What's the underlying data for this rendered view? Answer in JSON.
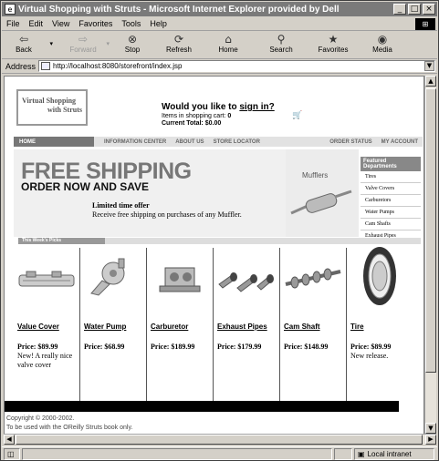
{
  "window": {
    "title": "Virtual Shopping with Struts - Microsoft Internet Explorer provided by Dell",
    "controls": [
      "_",
      "□",
      "×"
    ]
  },
  "menu": {
    "items": [
      "File",
      "Edit",
      "View",
      "Favorites",
      "Tools",
      "Help"
    ]
  },
  "toolbar": {
    "buttons": [
      {
        "label": "Back",
        "icon": "back-arrow-icon",
        "glyph": "⇦"
      },
      {
        "label": "Forward",
        "icon": "forward-arrow-icon",
        "glyph": "⇨"
      },
      {
        "label": "Stop",
        "icon": "stop-icon",
        "glyph": "⊗"
      },
      {
        "label": "Refresh",
        "icon": "refresh-icon",
        "glyph": "⟳"
      },
      {
        "label": "Home",
        "icon": "home-icon",
        "glyph": "⌂"
      },
      {
        "label": "Search",
        "icon": "search-icon",
        "glyph": "⚲"
      },
      {
        "label": "Favorites",
        "icon": "favorites-icon",
        "glyph": "★"
      },
      {
        "label": "Media",
        "icon": "media-icon",
        "glyph": "◉"
      }
    ]
  },
  "address": {
    "label": "Address",
    "url": "http://localhost:8080/storefront/index.jsp"
  },
  "page": {
    "logo": {
      "line1": "Virtual Shopping",
      "line2": "with Struts"
    },
    "welcome": {
      "question": "Would you like to",
      "signin": "sign in?",
      "items_label": "Items in shopping cart:",
      "items_count": "0",
      "total_label": "Current Total:",
      "total_value": "$0.00"
    },
    "nav": {
      "home": "HOME",
      "left": [
        "INFORMATION CENTER",
        "ABOUT US",
        "STORE LOCATOR"
      ],
      "right": [
        "ORDER STATUS",
        "MY ACCOUNT"
      ]
    },
    "banner": {
      "headline": "FREE SHIPPING",
      "subhead": "ORDER NOW AND SAVE",
      "offer": "Limited time offer",
      "desc": "Receive free shipping on purchases of any Muffler.",
      "panel_label": "Mufflers"
    },
    "featured": {
      "heading": "Featured Departments",
      "items": [
        "Tires",
        "Valve Covers",
        "Carburetors",
        "Water Pumps",
        "Cam Shafts",
        "Exhaust Pipes"
      ]
    },
    "week_label": "This Week's Picks",
    "products": [
      {
        "name": "Value Cover",
        "price": "Price: $89.99",
        "note": "New! A really nice valve cover",
        "icon": "valve-cover-icon"
      },
      {
        "name": "Water Pump",
        "price": "Price: $68.99",
        "note": "",
        "icon": "water-pump-icon"
      },
      {
        "name": "Carburetor",
        "price": "Price: $189.99",
        "note": "",
        "icon": "carburetor-icon"
      },
      {
        "name": "Exhaust Pipes",
        "price": "Price: $179.99",
        "note": "",
        "icon": "exhaust-pipes-icon"
      },
      {
        "name": "Cam Shaft",
        "price": "Price: $148.99",
        "note": "",
        "icon": "cam-shaft-icon"
      },
      {
        "name": "Tire",
        "price": "Price: $89.99",
        "note": "New release.",
        "icon": "tire-icon"
      }
    ],
    "copyright": {
      "line1": "Copyright © 2000-2002.",
      "line2": "To be used with the OReilly Struts book only."
    }
  },
  "status": {
    "zone": "Local intranet"
  }
}
